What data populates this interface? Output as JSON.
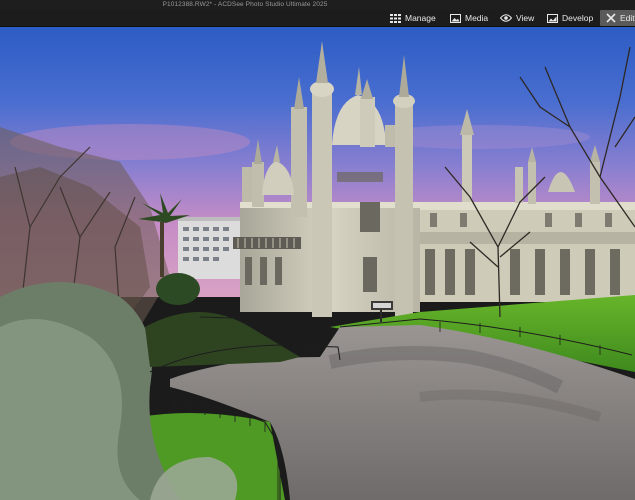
{
  "window": {
    "title": "P1012388.RW2* - ACDSee Photo Studio Ultimate 2025"
  },
  "modes": {
    "manage": {
      "label": "Manage",
      "icon": "grid-icon"
    },
    "media": {
      "label": "Media",
      "icon": "photo-icon"
    },
    "view": {
      "label": "View",
      "icon": "eye-icon"
    },
    "develop": {
      "label": "Develop",
      "icon": "develop-icon"
    },
    "edit": {
      "label": "Edit",
      "icon": "edit-tools-icon",
      "active": true
    }
  },
  "colors": {
    "accent_active_mode": "#5a5a5a",
    "titlebar": "#1e1e1e",
    "sky_top": "#2d5fc4",
    "sky_dusk": "#c98bbf"
  }
}
